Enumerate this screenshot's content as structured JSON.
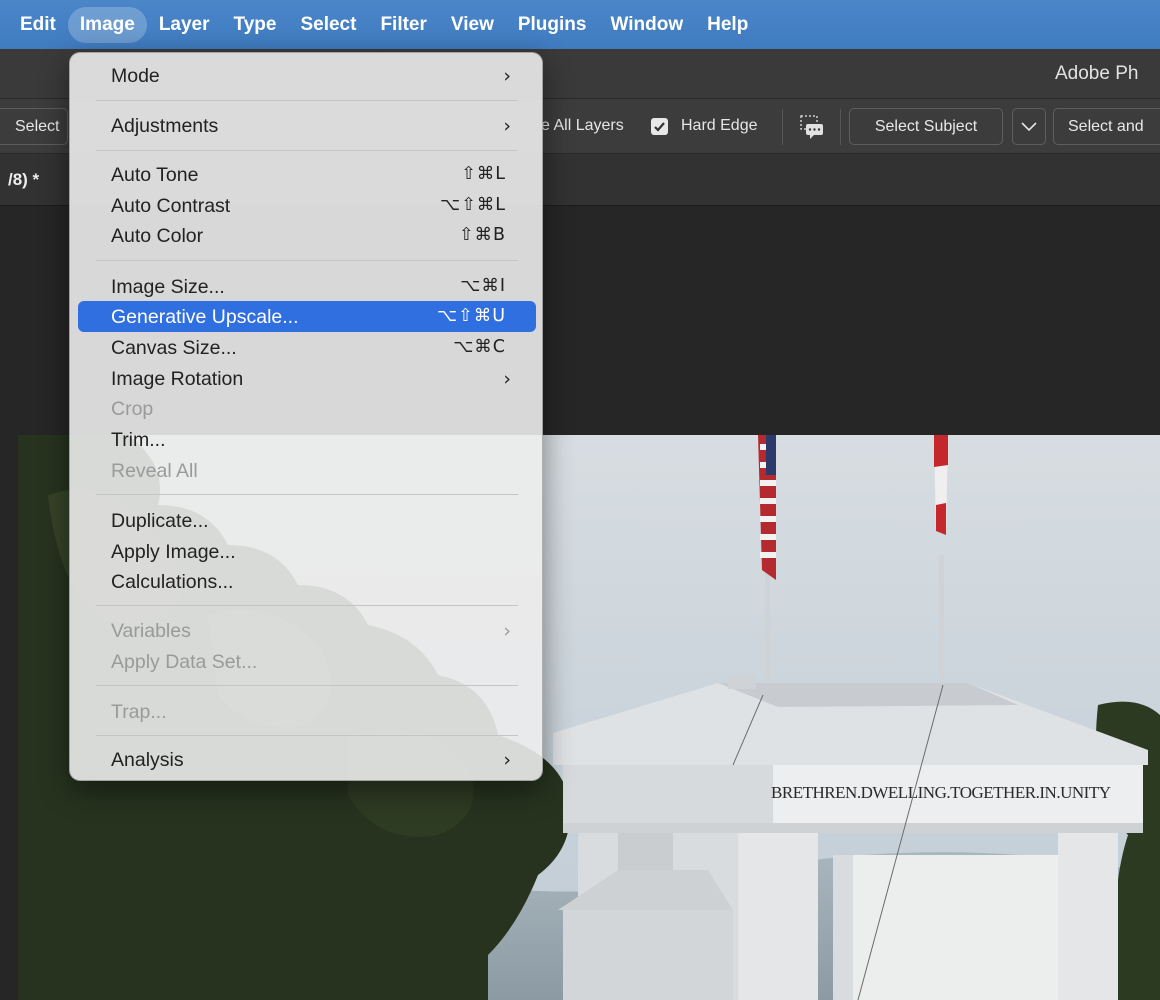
{
  "menubar": {
    "items": [
      {
        "label": "Edit"
      },
      {
        "label": "Image"
      },
      {
        "label": "Layer"
      },
      {
        "label": "Type"
      },
      {
        "label": "Select"
      },
      {
        "label": "Filter"
      },
      {
        "label": "View"
      },
      {
        "label": "Plugins"
      },
      {
        "label": "Window"
      },
      {
        "label": "Help"
      }
    ],
    "active": "Image"
  },
  "titlebar": {
    "app_title": "Adobe Ph"
  },
  "options_bar": {
    "select_button": "Select",
    "sample_all_layers": "e All Layers",
    "hard_edge_label": "Hard Edge",
    "hard_edge_checked": true,
    "select_subject": "Select Subject",
    "select_and_mask": "Select and"
  },
  "document_tab": {
    "label": "/8) *"
  },
  "image_menu": {
    "groups": [
      [
        {
          "label": "Mode",
          "submenu": true
        },
        {
          "label": "Adjustments",
          "submenu": true
        }
      ],
      [
        {
          "label": "Auto Tone",
          "shortcut": "⇧⌘L"
        },
        {
          "label": "Auto Contrast",
          "shortcut": "⌥⇧⌘L"
        },
        {
          "label": "Auto Color",
          "shortcut": "⇧⌘B"
        }
      ],
      [
        {
          "label": "Image Size...",
          "shortcut": "⌥⌘I"
        },
        {
          "label": "Generative Upscale...",
          "shortcut": "⌥⇧⌘U",
          "highlighted": true
        },
        {
          "label": "Canvas Size...",
          "shortcut": "⌥⌘C"
        },
        {
          "label": "Image Rotation",
          "submenu": true
        },
        {
          "label": "Crop",
          "disabled": true
        },
        {
          "label": "Trim..."
        },
        {
          "label": "Reveal All",
          "disabled": true
        }
      ],
      [
        {
          "label": "Duplicate..."
        },
        {
          "label": "Apply Image..."
        },
        {
          "label": "Calculations..."
        }
      ],
      [
        {
          "label": "Variables",
          "submenu": true,
          "disabled": true
        },
        {
          "label": "Apply Data Set...",
          "disabled": true
        }
      ],
      [
        {
          "label": "Trap...",
          "disabled": true
        }
      ],
      [
        {
          "label": "Analysis",
          "submenu": true
        }
      ]
    ],
    "submenu_arrow": "›"
  },
  "photo": {
    "inscription": "BRETHREN.DWELLING.TOGETHER.IN.UNITY",
    "colors": {
      "sky": "#c9d4dc",
      "arch": "#e6e8ea",
      "trees": "#243020"
    }
  }
}
